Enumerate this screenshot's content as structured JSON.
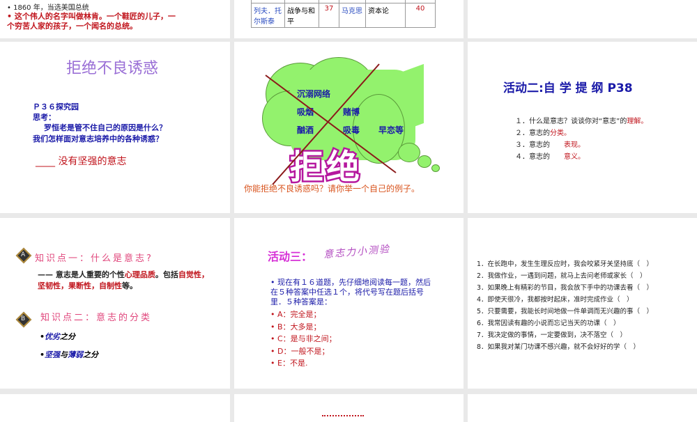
{
  "slides": [
    {
      "bullets": [
        "1860 年，当选美国总统",
        "这个伟人的名字叫做林肯。一个鞋匠的儿子，一个穷苦人家的孩子，一个闻名的总统。"
      ]
    },
    {
      "table_row_partial": "40",
      "table_row": [
        "列夫．托尔斯泰",
        "战争与和平",
        "37",
        "马克思",
        "资本论",
        "40"
      ]
    },
    {},
    {
      "title": "拒绝不良诱惑",
      "lines": [
        "Ｐ３６探究园",
        "思考：",
        "罗恒老是管不住自己的原因是什么？",
        "我们怎样面对意志培养中的各种诱惑？"
      ],
      "answer_blank": "____",
      "answer": "没有坚强的意志"
    },
    {
      "items": [
        "沉溺网络",
        "吸烟",
        "赌博",
        "酗酒",
        "吸毒",
        "早恋等"
      ],
      "big_word": "拒绝",
      "question": "你能拒绝不良诱惑吗？请你举一个自己的例子。"
    },
    {
      "title": "活动二:自 学 提 纲 P38",
      "items": [
        {
          "num": "１．",
          "text": "什么是意志？谈谈你对“意志”的",
          "hl": "理解。"
        },
        {
          "num": "２．",
          "text": "意志的",
          "hl": "分类。"
        },
        {
          "num": "３．",
          "text": "意志的　　",
          "hl": "表现。"
        },
        {
          "num": "４．",
          "text": "意志的　　",
          "hl": "意义。"
        }
      ]
    },
    {
      "k1_badge": "A",
      "k1_title": "知识点一：什么是意志?",
      "k1_text_a": "—— 意志是人重要的个性",
      "k1_hl1": "心理品质",
      "k1_text_b": "。包括",
      "k1_hl2": "自觉性，坚韧性，果断性，自制性",
      "k1_text_c": "等。",
      "k2_badge": "B",
      "k2_title": "知识点二：意志的分类",
      "k2_items": [
        {
          "a": "优劣",
          "b": "之分"
        },
        {
          "a": "坚强",
          "b": "与",
          "c": "薄弱",
          "d": "之分"
        }
      ]
    },
    {
      "title_a": "活动三：",
      "title_b": "意志力小测验",
      "intro": "现在有１６道题，先仔细地阅读每一题，然后在５种答案中任选１个，将代号写在题后括号里．５种答案是：",
      "options": [
        "A：完全是；",
        "B：大多是；",
        "C：是与非之间；",
        "D：一般不是；",
        "E：不是."
      ]
    },
    {
      "questions": [
        "1．在长跑中，发生生理反应时，我会咬紧牙关坚持底（　）",
        "2．我做作业，一遇到问题，就马上去问老师或家长（　）",
        "3．如果晚上有精彩的节目，我会放下手中的功课去看（　）",
        "4．即使天很冷，我都按时起床，准时完成作业（　）",
        "5．只要需要，我能长时间地做一件单调而无兴趣的事（　）",
        "6．我常因读有趣的小说而忘记当天的功课（　）",
        "7．我决定做的事情，一定要做到，决不落空（　）",
        "8．如果我对某门功课不感兴趣，就不会好好的学（　）"
      ]
    }
  ]
}
